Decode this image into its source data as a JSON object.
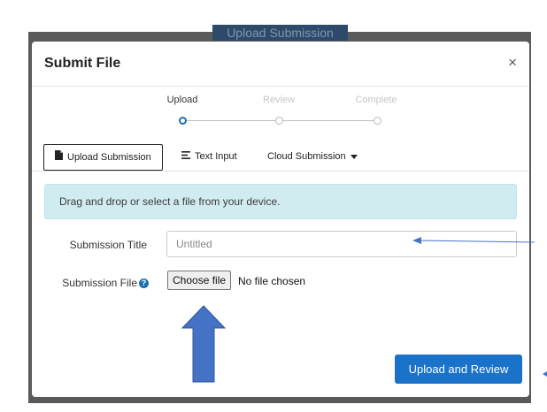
{
  "backdrop": {
    "button_label": "Upload Submission"
  },
  "dialog": {
    "title": "Submit File",
    "close_glyph": "×"
  },
  "stepper": {
    "steps": [
      {
        "label": "Upload",
        "state": "active"
      },
      {
        "label": "Review",
        "state": "inactive"
      },
      {
        "label": "Complete",
        "state": "inactive"
      }
    ]
  },
  "tabs": [
    {
      "label": "Upload Submission",
      "icon": "file-icon",
      "selected": true
    },
    {
      "label": "Text Input",
      "icon": "align-left-icon",
      "selected": false
    },
    {
      "label": "Cloud Submission",
      "icon": "caret-down-icon",
      "selected": false
    }
  ],
  "info": {
    "message": "Drag and drop or select a file from your device."
  },
  "form": {
    "title_label": "Submission Title",
    "title_placeholder": "Untitled",
    "title_value": "",
    "file_label": "Submission File",
    "help_glyph": "?",
    "file_button_label": "Choose file",
    "file_status": "No file chosen"
  },
  "actions": {
    "primary_label": "Upload and Review"
  },
  "colors": {
    "accent": "#1a73c9",
    "info_bg": "#d1ecf1",
    "annotation_arrow": "#4472c4"
  }
}
